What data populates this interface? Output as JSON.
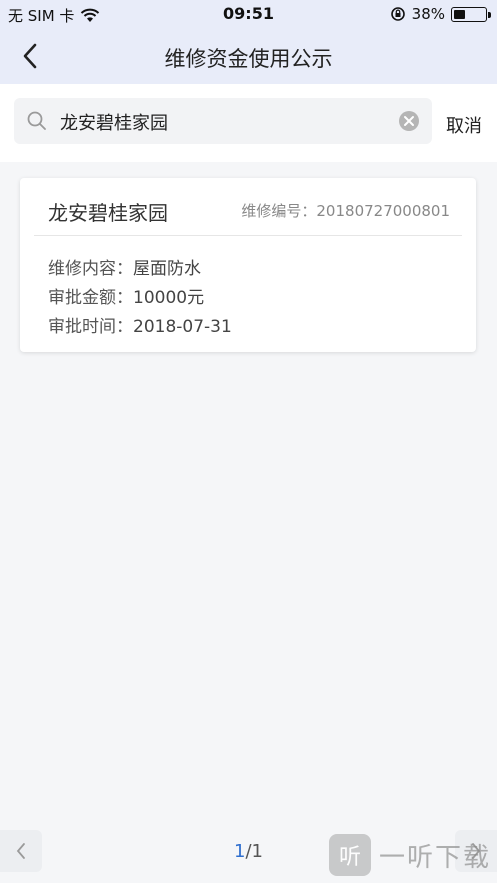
{
  "status_bar": {
    "carrier": "无 SIM 卡",
    "time": "09:51",
    "battery_percent": "38%",
    "battery_level": 0.38
  },
  "nav": {
    "title": "维修资金使用公示",
    "back_icon": "chevron-left-icon"
  },
  "search": {
    "value": "龙安碧桂家园",
    "placeholder": "",
    "cancel_label": "取消"
  },
  "results": [
    {
      "title": "龙安碧桂家园",
      "code_label": "维修编号：",
      "code_value": "20180727000801",
      "content_label": "维修内容：",
      "content_value": "屋面防水",
      "amount_label": "审批金额：",
      "amount_value": "10000元",
      "date_label": "审批时间：",
      "date_value": "2018-07-31"
    }
  ],
  "pager": {
    "current": "1",
    "separator": "/",
    "total": "1"
  },
  "watermark": {
    "badge": "听",
    "text": "一听下载"
  },
  "colors": {
    "header_bg": "#e8ecf9",
    "accent": "#2f6fcf"
  }
}
